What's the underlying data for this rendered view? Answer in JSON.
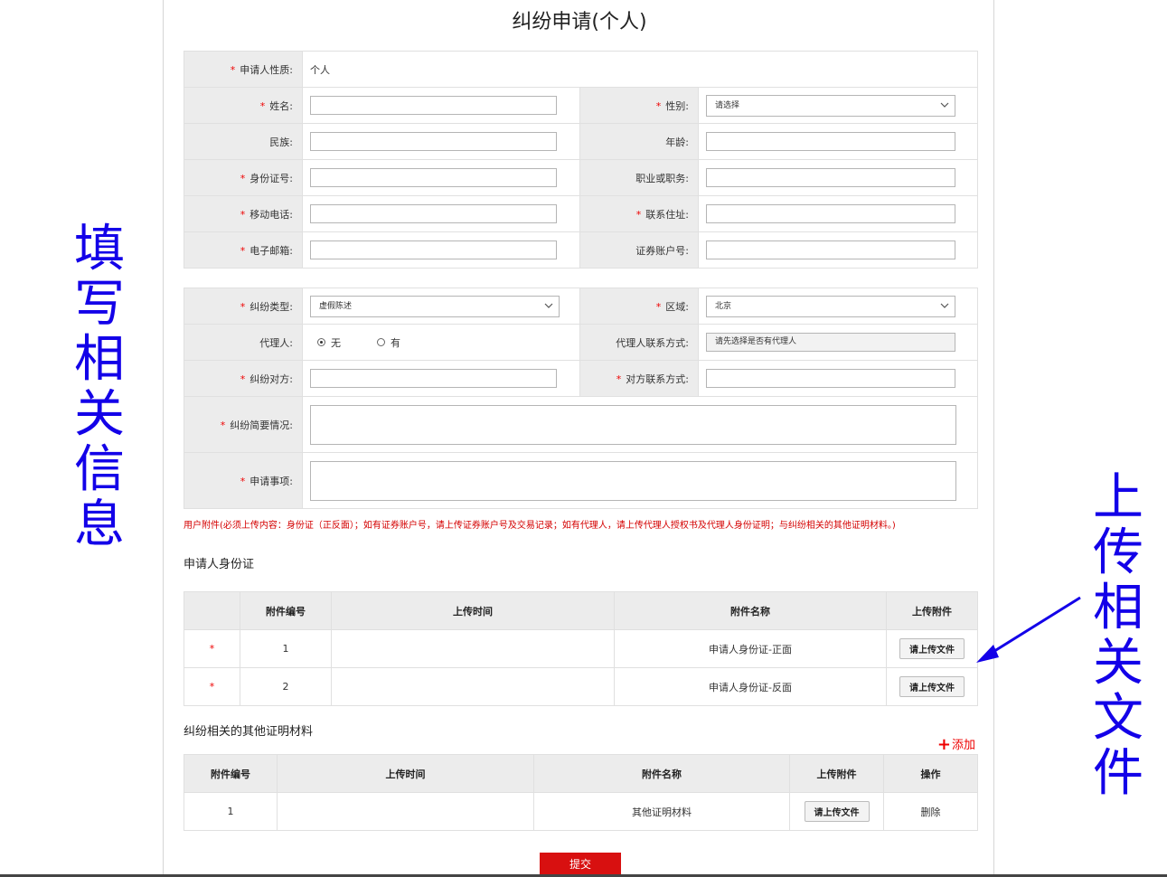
{
  "page_title": "纠纷申请(个人)",
  "applicant_type": {
    "label": "申请人性质:",
    "value": "个人"
  },
  "personal": {
    "name_label": "姓名:",
    "gender_label": "性别:",
    "gender_value": "请选择",
    "ethnicity_label": "民族:",
    "age_label": "年龄:",
    "id_label": "身份证号:",
    "occupation_label": "职业或职务:",
    "mobile_label": "移动电话:",
    "address_label": "联系住址:",
    "email_label": "电子邮箱:",
    "securities_label": "证券账户号:"
  },
  "dispute": {
    "type_label": "纠纷类型:",
    "type_value": "虚假陈述",
    "region_label": "区域:",
    "region_value": "北京",
    "agent_label": "代理人:",
    "agent_options": [
      "无",
      "有"
    ],
    "agent_selected": 0,
    "agent_contact_label": "代理人联系方式:",
    "agent_contact_placeholder": "请先选择是否有代理人",
    "counterparty_label": "纠纷对方:",
    "counterparty_contact_label": "对方联系方式:",
    "summary_label": "纠纷简要情况:",
    "request_label": "申请事项:"
  },
  "required_mark": "*",
  "notice": "用户附件(必须上传内容：身份证（正反面）；如有证券账户号，请上传证券账户号及交易记录；如有代理人，请上传代理人授权书及代理人身份证明；与纠纷相关的其他证明材料。)",
  "id_section": {
    "title": "申请人身份证",
    "headers": [
      "附件编号",
      "上传时间",
      "附件名称",
      "上传附件"
    ],
    "rows": [
      {
        "no": "1",
        "time": "",
        "name": "申请人身份证-正面",
        "button": "请上传文件"
      },
      {
        "no": "2",
        "time": "",
        "name": "申请人身份证-反面",
        "button": "请上传文件"
      }
    ]
  },
  "other_section": {
    "title": "纠纷相关的其他证明材料",
    "add_label": "添加",
    "headers": [
      "附件编号",
      "上传时间",
      "附件名称",
      "上传附件",
      "操作"
    ],
    "rows": [
      {
        "no": "1",
        "time": "",
        "name": "其他证明材料",
        "button": "请上传文件",
        "action": "删除"
      }
    ]
  },
  "submit_label": "提交",
  "annotations": {
    "left": [
      "填",
      "写",
      "相",
      "关",
      "信",
      "息"
    ],
    "right": [
      "上",
      "传",
      "相",
      "关",
      "文",
      "件"
    ],
    "color": "#1300e8"
  },
  "colors": {
    "required": "#e00000",
    "submit": "#d81010",
    "label_bg": "#ececec"
  }
}
